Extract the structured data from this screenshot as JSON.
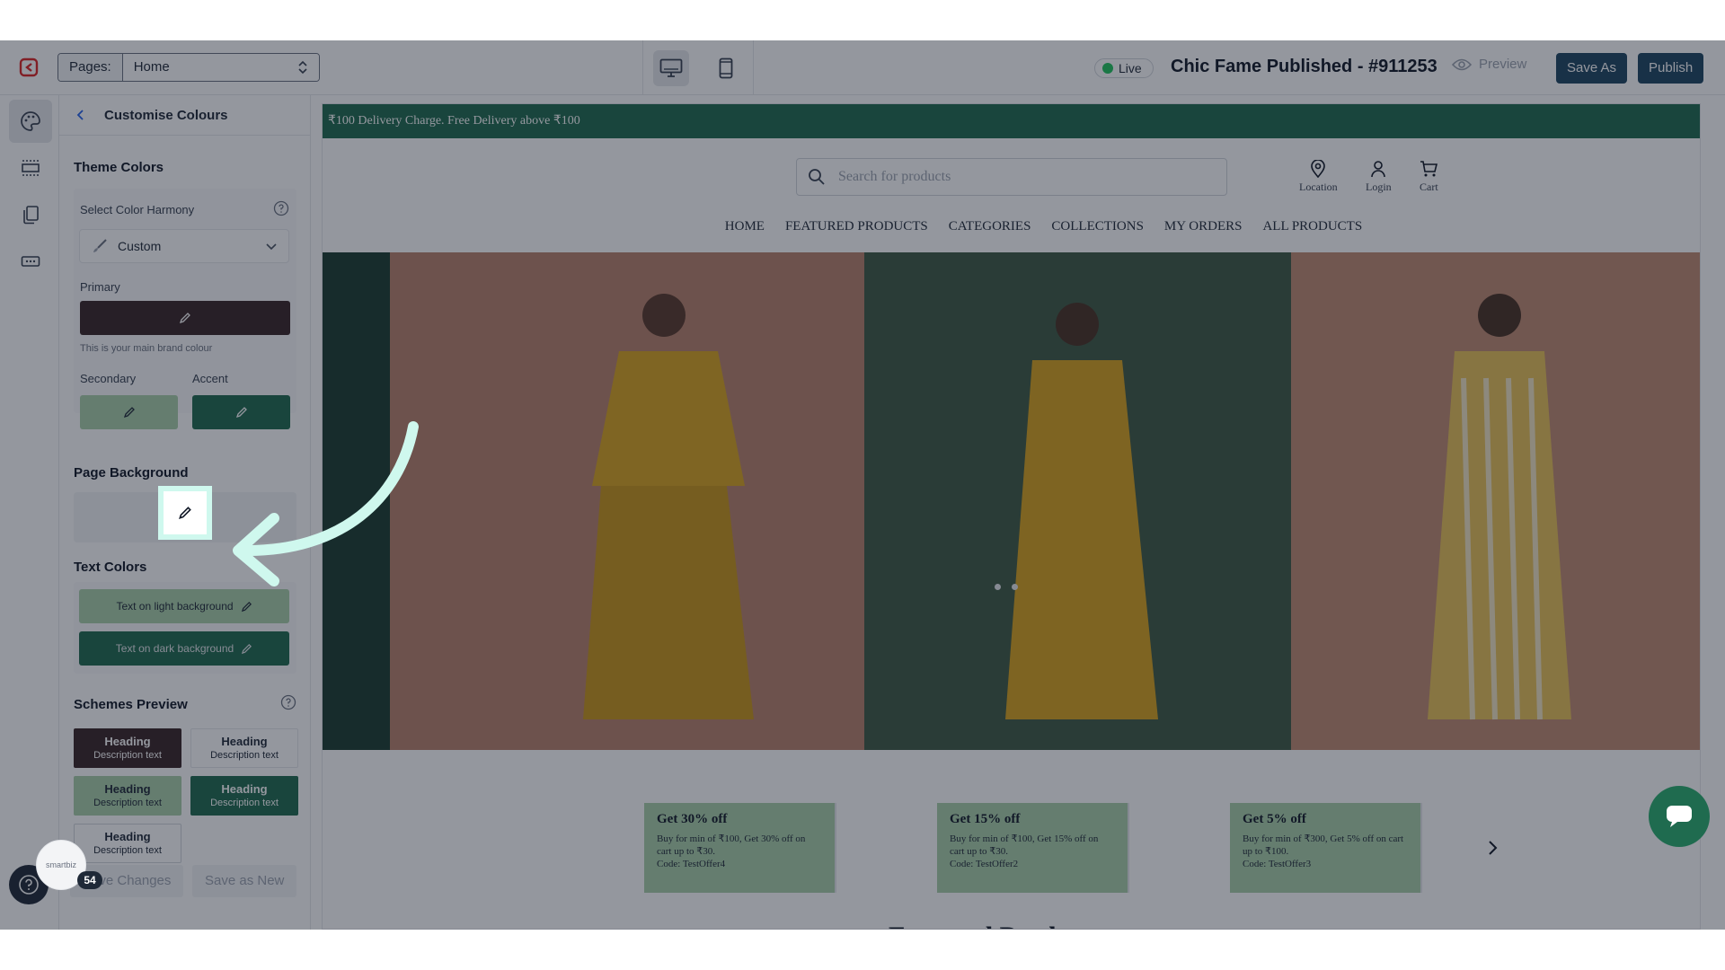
{
  "topbar": {
    "pages_label": "Pages:",
    "page_selected": "Home",
    "live_label": "Live",
    "store_title": "Chic Fame Published - #911253",
    "preview_label": "Preview",
    "save_as_label": "Save As",
    "publish_label": "Publish"
  },
  "panel": {
    "title": "Customise Colours",
    "theme_colors": "Theme Colors",
    "harmony_label": "Select Color Harmony",
    "harmony_value": "Custom",
    "primary_label": "Primary",
    "primary_hint": "This is your main brand colour",
    "secondary_label": "Secondary",
    "accent_label": "Accent",
    "page_background": "Page Background",
    "text_colors": "Text Colors",
    "text_light": "Text on light background",
    "text_dark": "Text on dark background",
    "schemes_preview": "Schemes Preview",
    "schemes": [
      {
        "heading": "Heading",
        "desc": "Description text"
      },
      {
        "heading": "Heading",
        "desc": "Description text"
      },
      {
        "heading": "Heading",
        "desc": "Description text"
      },
      {
        "heading": "Heading",
        "desc": "Description text"
      },
      {
        "heading": "Heading",
        "desc": "Description text"
      }
    ],
    "save_changes": "Save Changes",
    "save_as_new": "Save as New"
  },
  "colors": {
    "primary": "#3a2527",
    "secondary": "#a9cfa9",
    "accent": "#1f6b4f",
    "page_background": "#f9fafb",
    "highlight": "#cff8ee"
  },
  "preview": {
    "announcement": "₹100 Delivery Charge. Free Delivery above ₹100",
    "search_placeholder": "Search for products",
    "location": "Location",
    "login": "Login",
    "cart": "Cart",
    "nav": [
      "HOME",
      "FEATURED PRODUCTS",
      "CATEGORIES",
      "COLLECTIONS",
      "MY ORDERS",
      "ALL PRODUCTS"
    ],
    "offers": [
      {
        "title": "Get 30% off",
        "body": "Buy for min of ₹100, Get 30% off on cart up to ₹30.",
        "code": "Code: TestOffer4"
      },
      {
        "title": "Get 15% off",
        "body": "Buy for min of ₹100, Get 15% off on cart up to ₹30.",
        "code": "Code: TestOffer2"
      },
      {
        "title": "Get 5% off",
        "body": "Buy for min of ₹300, Get 5% off on cart up to ₹100.",
        "code": "Code: TestOffer3"
      }
    ],
    "featured_heading": "Featured Products"
  },
  "misc": {
    "count_badge": "54",
    "badge_brand": "smartbiz"
  }
}
